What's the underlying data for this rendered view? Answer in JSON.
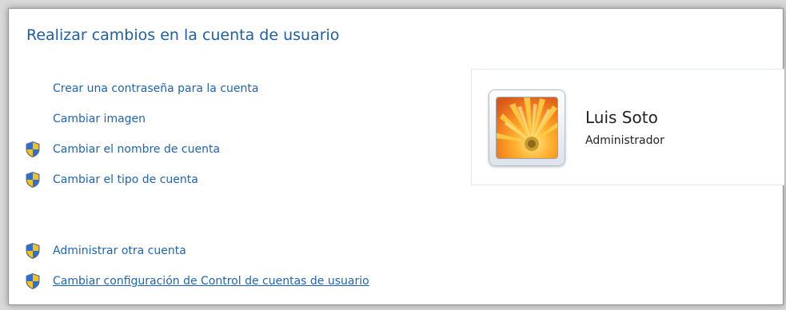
{
  "window": {
    "title": "Realizar cambios en la cuenta de usuario"
  },
  "tasks": [
    {
      "label": "Crear una contraseña para la cuenta",
      "icon": null
    },
    {
      "label": "Cambiar imagen",
      "icon": null
    },
    {
      "label": "Cambiar el nombre de cuenta",
      "icon": "uac-shield-icon"
    },
    {
      "label": "Cambiar el tipo de cuenta",
      "icon": "uac-shield-icon"
    }
  ],
  "other_tasks": [
    {
      "label": "Administrar otra cuenta",
      "icon": "uac-shield-icon"
    },
    {
      "label": "Cambiar configuración de Control de cuentas de usuario",
      "icon": "uac-shield-icon"
    }
  ],
  "user": {
    "name": "Luis Soto",
    "role": "Administrador",
    "avatar_icon": "flower-picture"
  },
  "colors": {
    "title": "#1e5fa8",
    "link": "#1e64b8",
    "text": "#222222"
  }
}
